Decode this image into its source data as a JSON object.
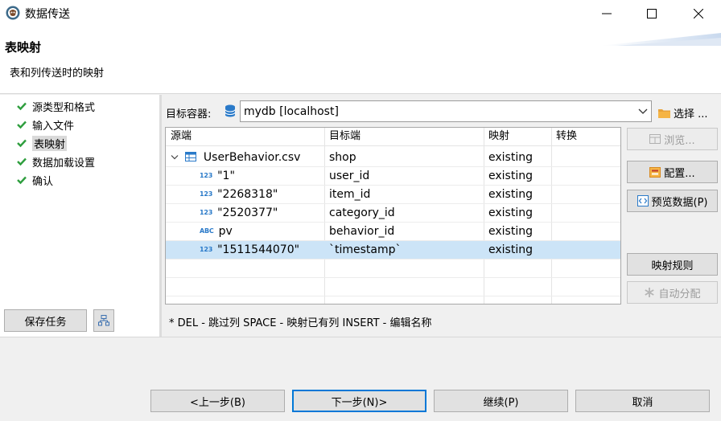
{
  "window": {
    "title": "数据传送"
  },
  "header": {
    "title": "表映射",
    "subtitle": "表和列传送时的映射"
  },
  "nav": {
    "items": [
      {
        "label": "源类型和格式",
        "selected": false
      },
      {
        "label": "输入文件",
        "selected": false
      },
      {
        "label": "表映射",
        "selected": true
      },
      {
        "label": "数据加载设置",
        "selected": false
      },
      {
        "label": "确认",
        "selected": false
      }
    ],
    "save_task_label": "保存任务"
  },
  "target": {
    "label": "目标容器:",
    "value": "mydb  [localhost]",
    "browse_label": "选择 ..."
  },
  "table": {
    "columns": [
      "源端",
      "目标端",
      "映射",
      "转换"
    ],
    "rows": [
      {
        "type": "table",
        "source": "UserBehavior.csv",
        "target": "shop",
        "mapping": "existing",
        "transform": ""
      },
      {
        "type": "123",
        "source": "\"1\"",
        "target": "user_id",
        "mapping": "existing",
        "transform": ""
      },
      {
        "type": "123",
        "source": "\"2268318\"",
        "target": "item_id",
        "mapping": "existing",
        "transform": ""
      },
      {
        "type": "123",
        "source": "\"2520377\"",
        "target": "category_id",
        "mapping": "existing",
        "transform": ""
      },
      {
        "type": "ABC",
        "source": "pv",
        "target": "behavior_id",
        "mapping": "existing",
        "transform": ""
      },
      {
        "type": "123",
        "source": "\"1511544070\"",
        "target": "`timestamp`",
        "mapping": "existing",
        "transform": "",
        "selected": true
      }
    ]
  },
  "side_buttons": {
    "browse": "浏览...",
    "configure": "配置...",
    "preview": "预览数据(P)",
    "mapping_rules": "映射规则",
    "auto_assign": "自动分配"
  },
  "hint": "* DEL - 跳过列  SPACE - 映射已有列  INSERT - 编辑名称",
  "footer": {
    "back": "<上一步(B)",
    "next": "下一步(N)>",
    "continue": "继续(P)",
    "cancel": "取消"
  },
  "colors": {
    "selection": "#cce4f7",
    "check": "#2e9e3e",
    "accent": "#0078d7"
  }
}
